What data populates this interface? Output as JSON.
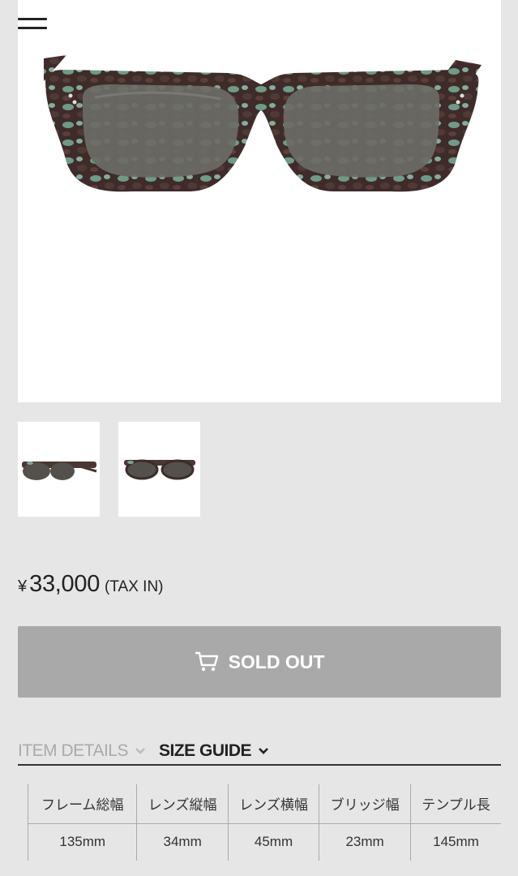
{
  "header": {
    "menu_icon": "hamburger-menu-icon"
  },
  "product": {
    "main_image": "sunglasses-front-view",
    "thumbnails": [
      "sunglasses-angle-view",
      "sunglasses-front-view"
    ],
    "price": {
      "currency": "¥",
      "amount": "33,000",
      "tax_note": "(TAX IN)"
    },
    "cta": {
      "label": "SOLD OUT",
      "icon": "cart-icon"
    }
  },
  "tabs": [
    {
      "label": "ITEM DETAILS",
      "active": false
    },
    {
      "label": "SIZE GUIDE",
      "active": true
    }
  ],
  "size_table": {
    "headers": [
      "フレーム総幅",
      "レンズ縦幅",
      "レンズ横幅",
      "ブリッジ幅",
      "テンプル長"
    ],
    "values": [
      "135mm",
      "34mm",
      "45mm",
      "23mm",
      "145mm"
    ]
  },
  "colors": {
    "page_bg": "#e6e6e6",
    "soldout_bg": "#a9a9a9",
    "text_primary": "#222222",
    "tab_inactive": "#aaaaaa"
  }
}
